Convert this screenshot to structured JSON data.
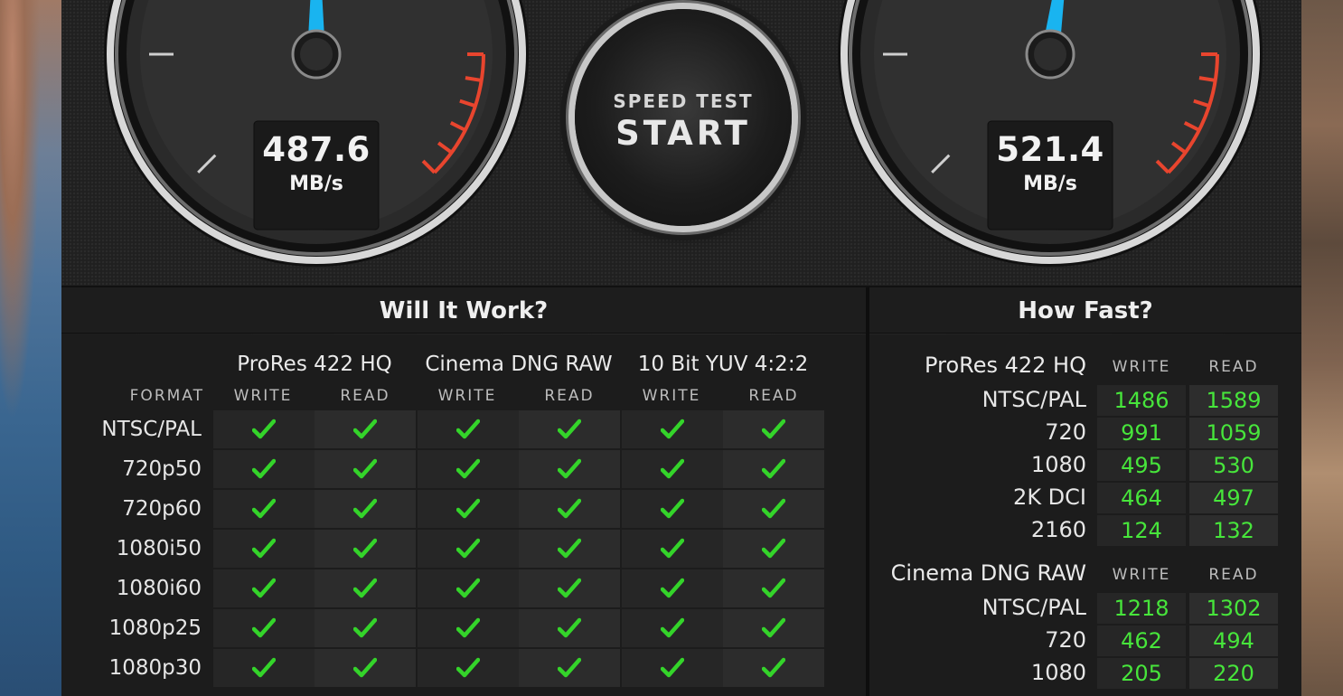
{
  "write_gauge": {
    "value": "487.6",
    "unit": "MB/s",
    "needle_fraction": 0.5
  },
  "read_gauge": {
    "value": "521.4",
    "unit": "MB/s",
    "needle_fraction": 0.53
  },
  "start_button": {
    "top_label": "SPEED TEST",
    "label": "START"
  },
  "will_it_work": {
    "title": "Will It Work?",
    "format_label": "FORMAT",
    "groups": [
      "ProRes 422 HQ",
      "Cinema DNG RAW",
      "10 Bit YUV 4:2:2"
    ],
    "subheaders": [
      "WRITE",
      "READ",
      "WRITE",
      "READ",
      "WRITE",
      "READ"
    ],
    "rows": [
      "NTSC/PAL",
      "720p50",
      "720p60",
      "1080i50",
      "1080i60",
      "1080p25",
      "1080p30"
    ],
    "check_color": "#34d42a"
  },
  "how_fast": {
    "title": "How Fast?",
    "sections": [
      {
        "name": "ProRes 422 HQ",
        "write_label": "WRITE",
        "read_label": "READ",
        "rows": [
          {
            "label": "NTSC/PAL",
            "write": "1486",
            "read": "1589"
          },
          {
            "label": "720",
            "write": "991",
            "read": "1059"
          },
          {
            "label": "1080",
            "write": "495",
            "read": "530"
          },
          {
            "label": "2K DCI",
            "write": "464",
            "read": "497"
          },
          {
            "label": "2160",
            "write": "124",
            "read": "132"
          }
        ]
      },
      {
        "name": "Cinema DNG RAW",
        "write_label": "WRITE",
        "read_label": "READ",
        "rows": [
          {
            "label": "NTSC/PAL",
            "write": "1218",
            "read": "1302"
          },
          {
            "label": "720",
            "write": "462",
            "read": "494"
          },
          {
            "label": "1080",
            "write": "205",
            "read": "220"
          }
        ]
      }
    ]
  },
  "colors": {
    "needle": "#19b4f0",
    "redline": "#e8452e",
    "value_green": "#47e53b"
  }
}
